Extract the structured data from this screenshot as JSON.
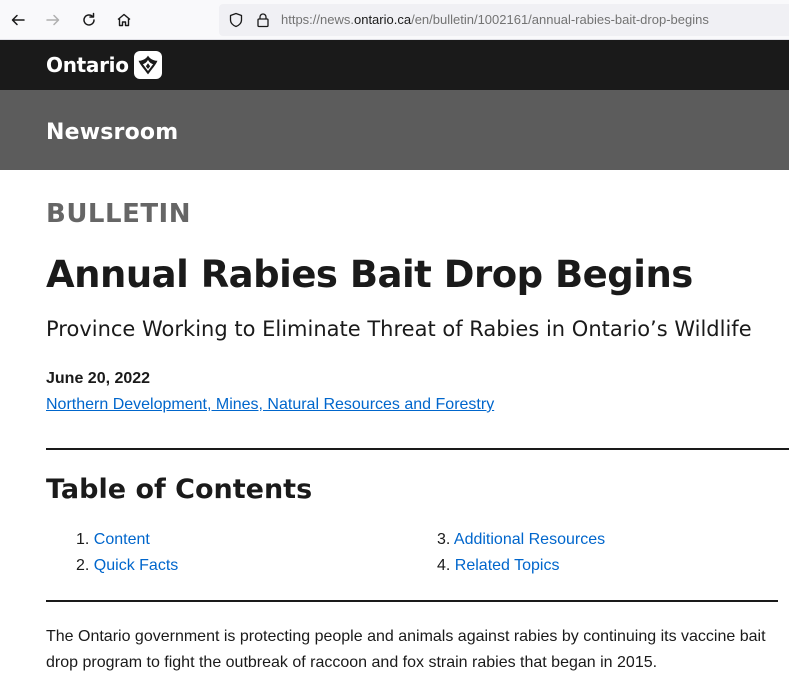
{
  "browser": {
    "url_prefix": "https://news.",
    "url_host": "ontario.ca",
    "url_path": "/en/bulletin/1002161/annual-rabies-bait-drop-begins",
    "back_icon": "arrow-left-icon",
    "forward_icon": "arrow-right-icon",
    "reload_icon": "reload-icon",
    "home_icon": "home-icon"
  },
  "header": {
    "brand": "Ontario",
    "section": "Newsroom"
  },
  "article": {
    "type_label": "BULLETIN",
    "title": "Annual Rabies Bait Drop Begins",
    "subtitle": "Province Working to Eliminate Threat of Rabies in Ontario’s Wildlife",
    "date": "June 20, 2022",
    "ministry": "Northern Development, Mines, Natural Resources and Forestry",
    "body": "The Ontario government is protecting people and animals against rabies by continuing its vaccine bait drop program to fight the outbreak of raccoon and fox strain rabies that began in 2015."
  },
  "toc": {
    "title": "Table of Contents",
    "items": [
      {
        "num": "1.",
        "label": "Content"
      },
      {
        "num": "2.",
        "label": "Quick Facts"
      },
      {
        "num": "3.",
        "label": "Additional Resources"
      },
      {
        "num": "4.",
        "label": "Related Topics"
      }
    ]
  },
  "colors": {
    "link": "#0066cc",
    "header_bg": "#1a1a1a",
    "newsroom_bg": "#5c5c5c"
  }
}
